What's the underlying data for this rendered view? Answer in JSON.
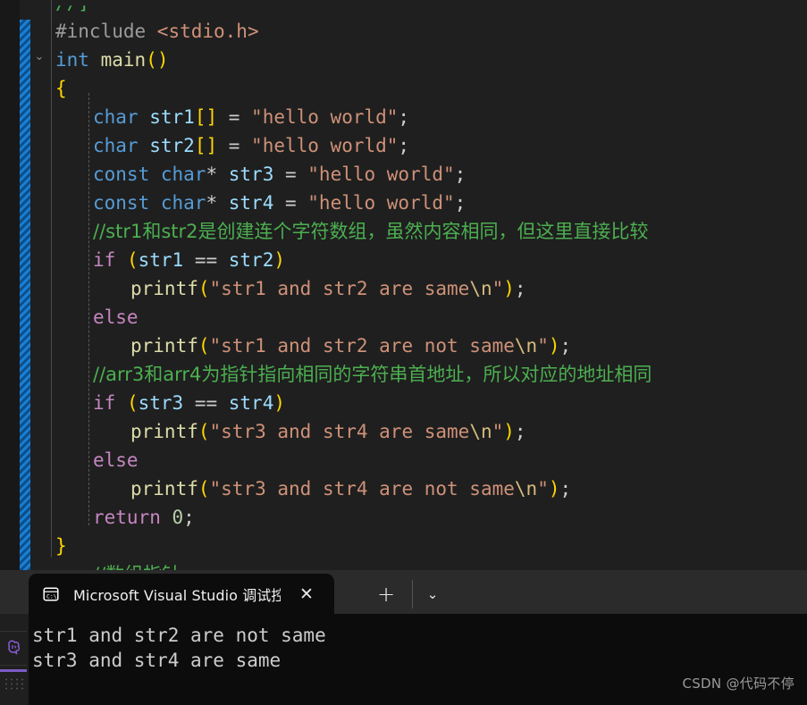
{
  "editor": {
    "language": "c",
    "gutter": {
      "fold_icon": "chevron-down-icon",
      "fold_state": "expanded"
    },
    "diff_indicator": {
      "type": "modified-lines-bar",
      "color": "#1a7fd4"
    },
    "lines": [
      {
        "indent": 0,
        "clipped_top": true,
        "tokens": [
          {
            "t": "//]",
            "c": "cmt"
          }
        ]
      },
      {
        "indent": 0,
        "tokens": [
          {
            "t": "#include ",
            "c": "pre"
          },
          {
            "t": "<stdio.h>",
            "c": "inc"
          }
        ]
      },
      {
        "indent": 0,
        "tokens": [
          {
            "t": "int",
            "c": "kw"
          },
          {
            "t": " ",
            "c": "pun"
          },
          {
            "t": "main",
            "c": "fn"
          },
          {
            "t": "()",
            "c": "br0"
          }
        ]
      },
      {
        "indent": 0,
        "tokens": [
          {
            "t": "{",
            "c": "br0"
          }
        ]
      },
      {
        "indent": 1,
        "tokens": [
          {
            "t": "char",
            "c": "kw"
          },
          {
            "t": " ",
            "c": "pun"
          },
          {
            "t": "str1",
            "c": "var"
          },
          {
            "t": "[]",
            "c": "br0"
          },
          {
            "t": " = ",
            "c": "pun"
          },
          {
            "t": "\"hello world\"",
            "c": "str"
          },
          {
            "t": ";",
            "c": "pun"
          }
        ]
      },
      {
        "indent": 1,
        "tokens": [
          {
            "t": "char",
            "c": "kw"
          },
          {
            "t": " ",
            "c": "pun"
          },
          {
            "t": "str2",
            "c": "var"
          },
          {
            "t": "[]",
            "c": "br0"
          },
          {
            "t": " = ",
            "c": "pun"
          },
          {
            "t": "\"hello world\"",
            "c": "str"
          },
          {
            "t": ";",
            "c": "pun"
          }
        ]
      },
      {
        "indent": 1,
        "tokens": [
          {
            "t": "const",
            "c": "kw"
          },
          {
            "t": " ",
            "c": "pun"
          },
          {
            "t": "char",
            "c": "kw"
          },
          {
            "t": "*",
            "c": "pun"
          },
          {
            "t": " ",
            "c": "pun"
          },
          {
            "t": "str3",
            "c": "var"
          },
          {
            "t": " = ",
            "c": "pun"
          },
          {
            "t": "\"hello world\"",
            "c": "str"
          },
          {
            "t": ";",
            "c": "pun"
          }
        ]
      },
      {
        "indent": 1,
        "tokens": [
          {
            "t": "const",
            "c": "kw"
          },
          {
            "t": " ",
            "c": "pun"
          },
          {
            "t": "char",
            "c": "kw"
          },
          {
            "t": "*",
            "c": "pun"
          },
          {
            "t": " ",
            "c": "pun"
          },
          {
            "t": "str4",
            "c": "var"
          },
          {
            "t": " = ",
            "c": "pun"
          },
          {
            "t": "\"hello world\"",
            "c": "str"
          },
          {
            "t": ";",
            "c": "pun"
          }
        ]
      },
      {
        "indent": 1,
        "cjk": true,
        "tokens": [
          {
            "t": "//str1和str2是创建连个字符数组，虽然内容相同，但这里直接比较",
            "c": "cmt"
          }
        ]
      },
      {
        "indent": 1,
        "tokens": [
          {
            "t": "if",
            "c": "ctl"
          },
          {
            "t": " ",
            "c": "pun"
          },
          {
            "t": "(",
            "c": "br0"
          },
          {
            "t": "str1",
            "c": "var"
          },
          {
            "t": " == ",
            "c": "pun"
          },
          {
            "t": "str2",
            "c": "var"
          },
          {
            "t": ")",
            "c": "br0"
          }
        ]
      },
      {
        "indent": 2,
        "tokens": [
          {
            "t": "printf",
            "c": "fn"
          },
          {
            "t": "(",
            "c": "br0"
          },
          {
            "t": "\"str1 and str2 are same",
            "c": "str"
          },
          {
            "t": "\\n",
            "c": "esc"
          },
          {
            "t": "\"",
            "c": "str"
          },
          {
            "t": ")",
            "c": "br0"
          },
          {
            "t": ";",
            "c": "pun"
          }
        ]
      },
      {
        "indent": 1,
        "tokens": [
          {
            "t": "else",
            "c": "ctl"
          }
        ]
      },
      {
        "indent": 2,
        "tokens": [
          {
            "t": "printf",
            "c": "fn"
          },
          {
            "t": "(",
            "c": "br0"
          },
          {
            "t": "\"str1 and str2 are not same",
            "c": "str"
          },
          {
            "t": "\\n",
            "c": "esc"
          },
          {
            "t": "\"",
            "c": "str"
          },
          {
            "t": ")",
            "c": "br0"
          },
          {
            "t": ";",
            "c": "pun"
          }
        ]
      },
      {
        "indent": 1,
        "cjk": true,
        "tokens": [
          {
            "t": "//arr3和arr4为指针指向相同的字符串首地址，所以对应的地址相同",
            "c": "cmt"
          }
        ]
      },
      {
        "indent": 1,
        "tokens": [
          {
            "t": "if",
            "c": "ctl"
          },
          {
            "t": " ",
            "c": "pun"
          },
          {
            "t": "(",
            "c": "br0"
          },
          {
            "t": "str3",
            "c": "var"
          },
          {
            "t": " == ",
            "c": "pun"
          },
          {
            "t": "str4",
            "c": "var"
          },
          {
            "t": ")",
            "c": "br0"
          }
        ]
      },
      {
        "indent": 2,
        "tokens": [
          {
            "t": "printf",
            "c": "fn"
          },
          {
            "t": "(",
            "c": "br0"
          },
          {
            "t": "\"str3 and str4 are same",
            "c": "str"
          },
          {
            "t": "\\n",
            "c": "esc"
          },
          {
            "t": "\"",
            "c": "str"
          },
          {
            "t": ")",
            "c": "br0"
          },
          {
            "t": ";",
            "c": "pun"
          }
        ]
      },
      {
        "indent": 1,
        "tokens": [
          {
            "t": "else",
            "c": "ctl"
          }
        ]
      },
      {
        "indent": 2,
        "tokens": [
          {
            "t": "printf",
            "c": "fn"
          },
          {
            "t": "(",
            "c": "br0"
          },
          {
            "t": "\"str3 and str4 are not same",
            "c": "str"
          },
          {
            "t": "\\n",
            "c": "esc"
          },
          {
            "t": "\"",
            "c": "str"
          },
          {
            "t": ")",
            "c": "br0"
          },
          {
            "t": ";",
            "c": "pun"
          }
        ]
      },
      {
        "indent": 1,
        "tokens": [
          {
            "t": "return",
            "c": "ctl"
          },
          {
            "t": " ",
            "c": "pun"
          },
          {
            "t": "0",
            "c": "num"
          },
          {
            "t": ";",
            "c": "pun"
          }
        ]
      },
      {
        "indent": 0,
        "tokens": [
          {
            "t": "}",
            "c": "br0"
          }
        ]
      },
      {
        "indent": 1,
        "cjk": true,
        "clipped_bottom": true,
        "tokens": [
          {
            "t": "//数组指针",
            "c": "cmt"
          }
        ]
      }
    ]
  },
  "terminal": {
    "tab": {
      "icon": "console-cmd-icon",
      "title": "Microsoft Visual Studio 调试控",
      "close_label": "✕"
    },
    "new_tab_label": "+",
    "dropdown_label": "⌄",
    "output": [
      "str1 and str2 are not same",
      "str3 and str4 are same"
    ]
  },
  "statusbar": {
    "copilot_icon": "copilot-brain-icon",
    "accent_color": "#7a5cc6"
  },
  "watermark": {
    "text": "CSDN @代码不停"
  }
}
